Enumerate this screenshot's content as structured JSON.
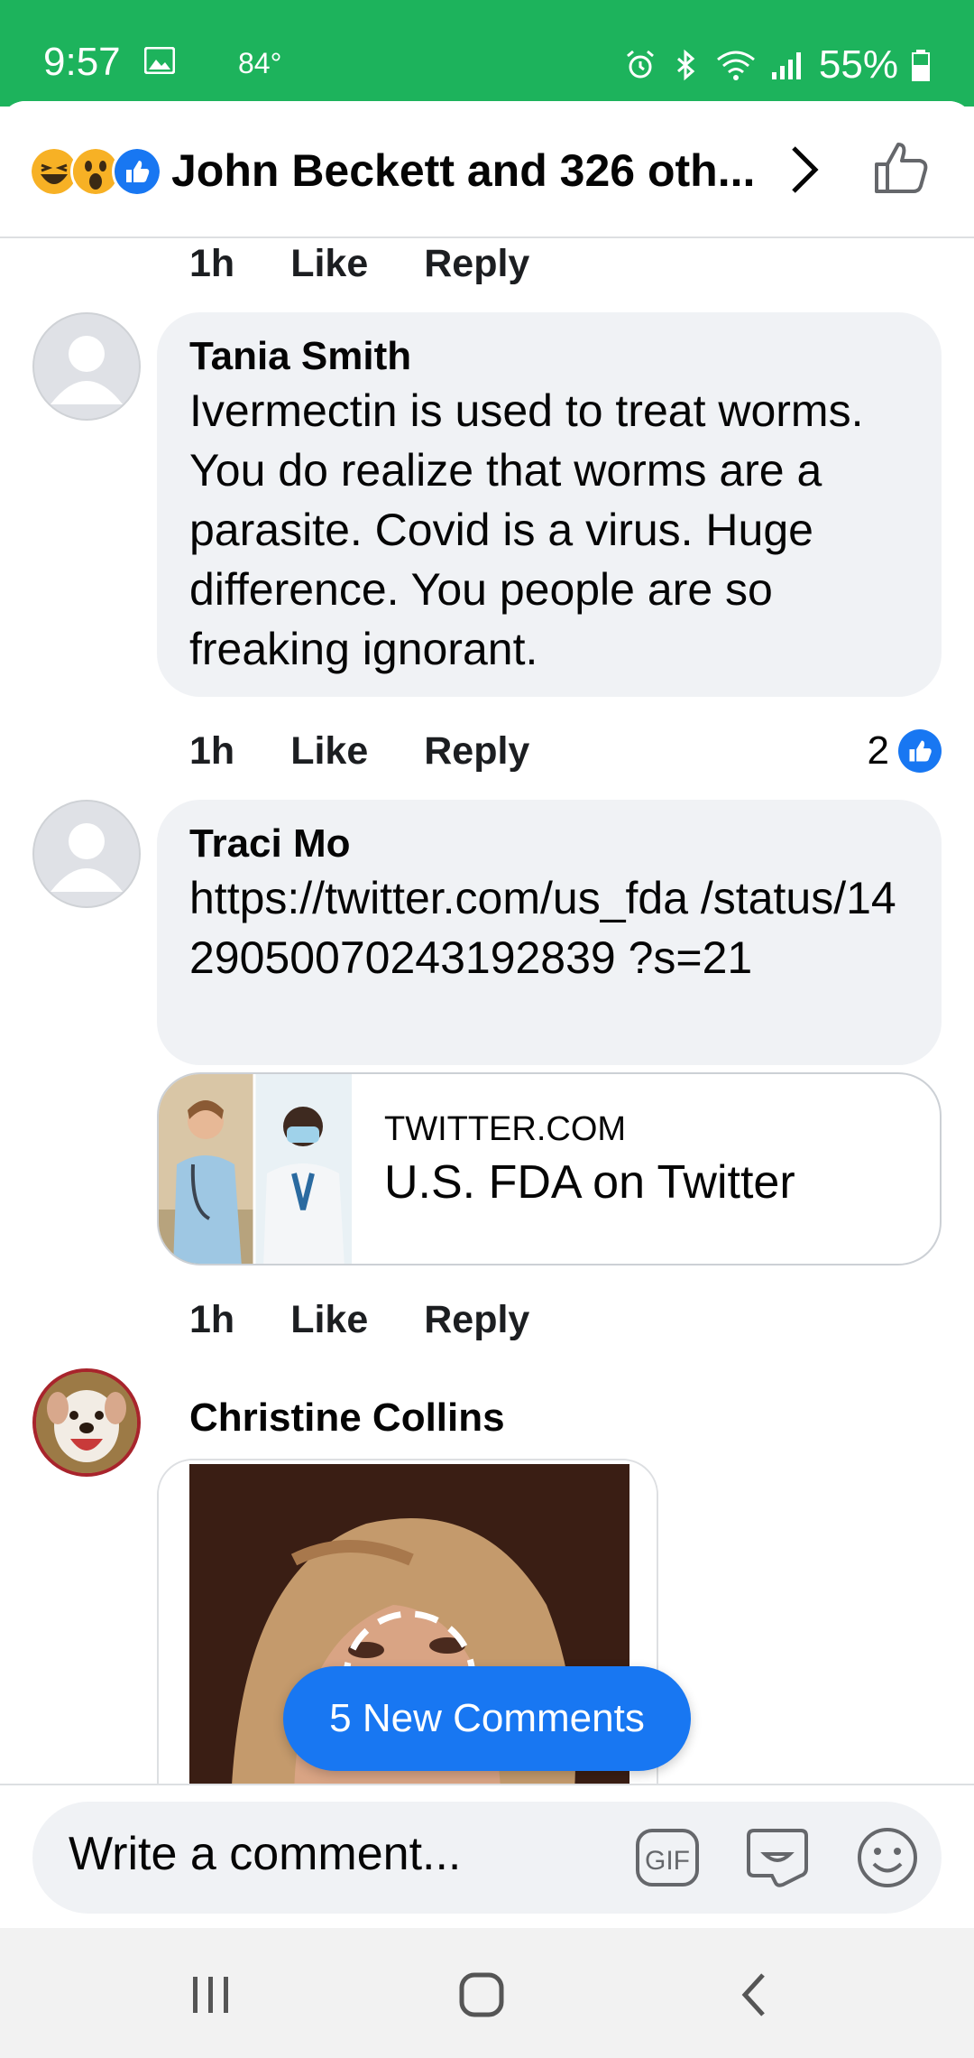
{
  "status_bar": {
    "time": "9:57",
    "temperature": "84°",
    "battery": "55%",
    "background_color": "#1db35c"
  },
  "header": {
    "reactions": [
      "laughing",
      "wow",
      "like"
    ],
    "title": "John Beckett and 326 oth..."
  },
  "comments": [
    {
      "meta": {
        "time": "1h",
        "like": "Like",
        "reply": "Reply"
      }
    },
    {
      "author": "Tania Smith",
      "text": "Ivermectin is used to treat worms. You do realize that worms are a parasite. Covid is a virus. Huge difference. You people are so freaking ignorant.",
      "meta": {
        "time": "1h",
        "like": "Like",
        "reply": "Reply"
      },
      "reaction_count": "2"
    },
    {
      "author": "Traci Mo",
      "text": "https://twitter.com/us_fda /status/1429050070243192839 ?s=21",
      "link_preview": {
        "domain": "TWITTER.COM",
        "title": "U.S. FDA on Twitter"
      },
      "meta": {
        "time": "1h",
        "like": "Like",
        "reply": "Reply"
      }
    },
    {
      "author": "Christine Collins"
    }
  ],
  "new_comments_button": "5 New Comments",
  "composer": {
    "placeholder": "Write a comment...",
    "icons": [
      "gif-icon",
      "sticker-icon",
      "emoji-icon"
    ]
  },
  "colors": {
    "accent": "#1877f2",
    "bubble": "#f0f2f5",
    "status_green": "#1db35c"
  }
}
